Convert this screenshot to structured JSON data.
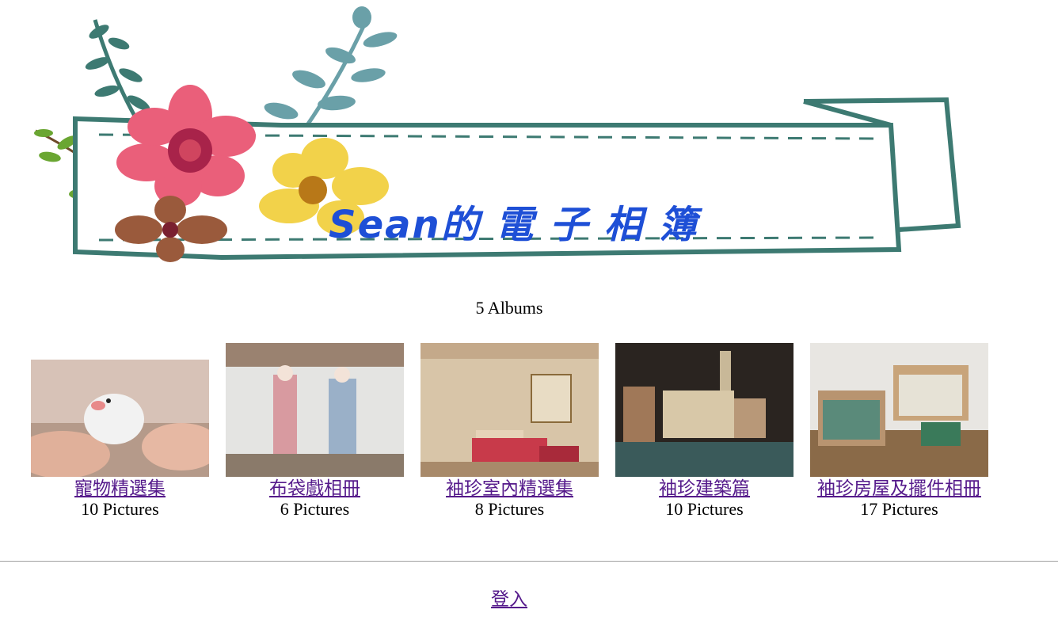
{
  "banner": {
    "title": "Sean的 電 子 相 簿"
  },
  "summary": {
    "album_count": "5 Albums"
  },
  "albums": [
    {
      "title": "寵物精選集",
      "count": "10 Pictures",
      "thumb": "white-bird-photo"
    },
    {
      "title": "布袋戲相冊",
      "count": "6 Pictures",
      "thumb": "puppet-figures-photo"
    },
    {
      "title": "袖珍室內精選集",
      "count": "8 Pictures",
      "thumb": "miniature-living-room-photo"
    },
    {
      "title": "袖珍建築篇",
      "count": "10 Pictures",
      "thumb": "miniature-building-photo"
    },
    {
      "title": "袖珍房屋及擺件相冊",
      "count": "17 Pictures",
      "thumb": "miniature-houses-photo"
    }
  ],
  "footer": {
    "login_label": "登入"
  }
}
